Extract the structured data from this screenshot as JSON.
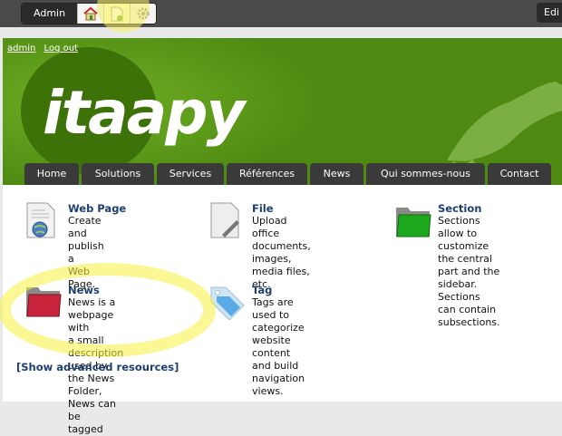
{
  "toolbar": {
    "admin_label": "Admin",
    "tools": [
      {
        "name": "home-icon"
      },
      {
        "name": "new-page-icon"
      },
      {
        "name": "gear-icon"
      }
    ],
    "edit_label": "Edi"
  },
  "header": {
    "user_links": [
      "admin",
      "Log out"
    ],
    "logo_text": "itaapy"
  },
  "nav": [
    "Home",
    "Solutions",
    "Services",
    "Références",
    "News",
    "Qui sommes-nous",
    "Contact"
  ],
  "resources": [
    {
      "title": "Web Page",
      "icon": "web-page-icon",
      "desc": [
        "Create and publish a",
        "Web Page."
      ]
    },
    {
      "title": "File",
      "icon": "file-icon",
      "desc": [
        "Upload office",
        "documents, images,",
        "media files, etc."
      ]
    },
    {
      "title": "Section",
      "icon": "section-folder-icon",
      "desc": [
        "Sections allow to",
        "customize the central",
        "part and the sidebar.",
        "Sections can contain",
        "subsections."
      ]
    },
    {
      "title": "News",
      "icon": "news-folder-icon",
      "desc": [
        "News is a webpage with",
        "a small description",
        "used by the News",
        "Folder, News can be",
        "tagged"
      ]
    },
    {
      "title": "Tag",
      "icon": "tag-icon",
      "desc": [
        "Tags are used to",
        "categorize website",
        "content and build",
        "navigation views."
      ]
    }
  ],
  "advanced_link": "[Show advanced resources]",
  "colors": {
    "header_green": "#4e8a12",
    "nav_bg": "#3a3a3a",
    "title_blue": "#1e3f6e",
    "highlight": "#f5f03c"
  }
}
